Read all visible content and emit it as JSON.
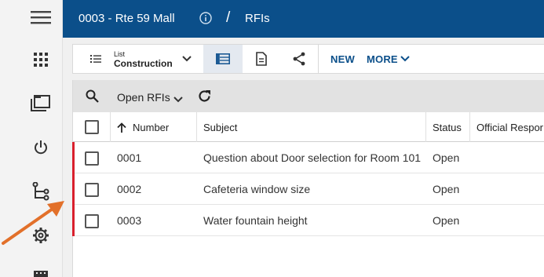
{
  "header": {
    "project": "0003 - Rte 59 Mall",
    "separator": "/",
    "current": "RFIs"
  },
  "toolbar": {
    "view_small": "List",
    "view_main": "Construction",
    "new_label": "NEW",
    "more_label": "MORE"
  },
  "filter": {
    "label": "Open RFIs"
  },
  "columns": [
    "Number",
    "Subject",
    "Status",
    "Official Respor"
  ],
  "rows": [
    {
      "number": "0001",
      "subject": "Question about Door selection for Room 101",
      "status": "Open"
    },
    {
      "number": "0002",
      "subject": "Cafeteria window size",
      "status": "Open"
    },
    {
      "number": "0003",
      "subject": "Water fountain height",
      "status": "Open"
    }
  ],
  "colors": {
    "header_bg": "#0b4f8a",
    "accent": "#0b4f8a",
    "flag": "#d9202d",
    "annotation_arrow": "#e2702a"
  }
}
